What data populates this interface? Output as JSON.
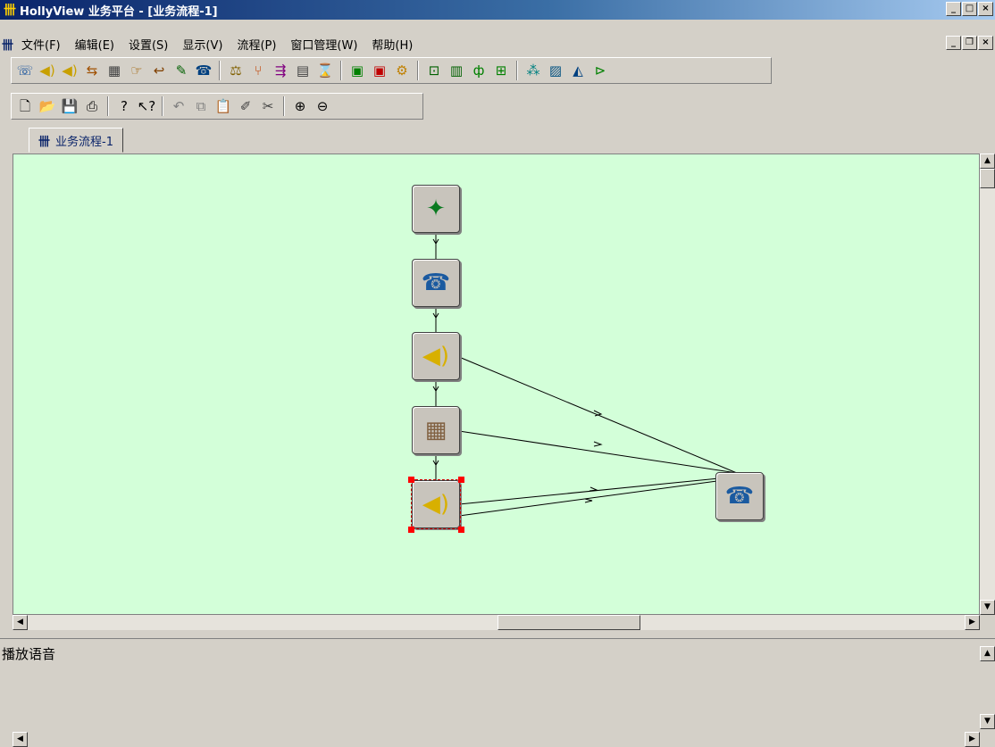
{
  "window": {
    "title": "HollyView 业务平台 - [业务流程-1]",
    "app_icon": "app-logo-icon",
    "buttons": [
      "_",
      "□",
      "×"
    ]
  },
  "menubar": {
    "items": [
      "文件(F)",
      "编辑(E)",
      "设置(S)",
      "显示(V)",
      "流程(P)",
      "窗口管理(W)",
      "帮助(H)"
    ],
    "mdi_buttons": [
      "_",
      "❐",
      "×"
    ]
  },
  "toolbar1": {
    "icons": [
      "phone-handset-icon",
      "speaker-icon",
      "speaker-record-icon",
      "transfer-icon",
      "grid-keypad-icon",
      "hand-keypad-icon",
      "return-icon",
      "pen-icon",
      "telephone-icon",
      "scale-icon",
      "branch-icon",
      "route-icon",
      "table-icon",
      "hourglass-icon",
      "matrix-icon",
      "matrix-red-icon",
      "gear-icon",
      "record-icon",
      "database-icon",
      "function-icon",
      "im-icon",
      "grid-dots-icon",
      "image-icon",
      "chart-icon",
      "dl-icon"
    ]
  },
  "toolbar2": {
    "icons": [
      "new-file-icon",
      "open-folder-icon",
      "save-icon",
      "print-icon",
      "help-icon",
      "context-help-icon",
      "undo-icon",
      "copy-icon",
      "paste-icon",
      "brush-icon",
      "cut-icon",
      "zoom-in-icon",
      "zoom-out-icon"
    ]
  },
  "tab": {
    "label": "业务流程-1"
  },
  "flow": {
    "nodes": [
      {
        "name": "start-node-icon",
        "glyph": "✦"
      },
      {
        "name": "incoming-call-node-icon",
        "glyph": "☎"
      },
      {
        "name": "play-voice-node-1-icon",
        "glyph": "🔊"
      },
      {
        "name": "key-input-node-icon",
        "glyph": "▦"
      },
      {
        "name": "play-voice-node-2-icon",
        "glyph": "🔊"
      },
      {
        "name": "hangup-phone-node-icon",
        "glyph": "☎"
      }
    ]
  },
  "status": {
    "text": "播放语音"
  }
}
